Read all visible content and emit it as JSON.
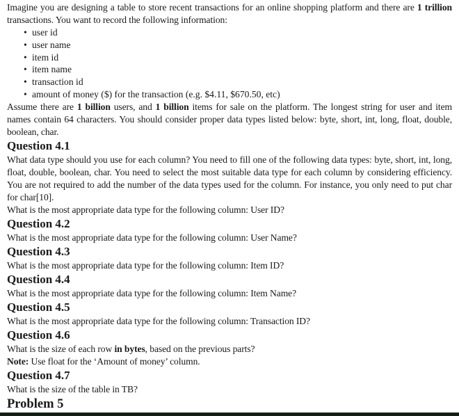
{
  "intro": {
    "part1": "Imagine you are designing a table to store recent transactions for an online shopping platform and there are ",
    "bold1": "1 trillion",
    "part2": " transactions. You want to record the following information:"
  },
  "fields": [
    "user id",
    "user name",
    "item id",
    "item name",
    "transaction id",
    "amount of money ($) for the transaction (e.g. $4.11, $670.50, etc)"
  ],
  "assumption": {
    "part1": "Assume there are ",
    "bold1": "1 billion",
    "part2": " users, and ",
    "bold2": "1 billion",
    "part3": " items for sale on the platform. The longest string for user and item names contain 64 characters. You should consider proper data types listed below: byte, short, int, long, float, double, boolean, char."
  },
  "questions": [
    {
      "title": "Question 4.1",
      "description": "What data type should you use for each column? You need to fill one of the following data types: byte, short, int, long, float, double, boolean, char. You need to select the most suitable data type for each column by considering efficiency. You are not required to add the number of the data types used for the column. For instance, you only need to put char for char[10].",
      "prompt": "What is the most appropriate data type for the following column: User ID?"
    },
    {
      "title": "Question 4.2",
      "prompt": "What is the most appropriate data type for the following column: User Name?"
    },
    {
      "title": "Question 4.3",
      "prompt": "What is the most appropriate data type for the following column: Item ID?"
    },
    {
      "title": "Question 4.4",
      "prompt": "What is the most appropriate data type for the following column: Item Name?"
    },
    {
      "title": "Question 4.5",
      "prompt": "What is the most appropriate data type for the following column: Transaction ID?"
    },
    {
      "title": "Question 4.6",
      "prompt_part1": "What is the size of each row ",
      "prompt_bold": "in bytes",
      "prompt_part2": ", based on the previous parts?",
      "note_label": "Note:",
      "note_text": " Use float for the ‘Amount of money’ column."
    },
    {
      "title": "Question 4.7",
      "prompt": "What is the size of the table in TB?"
    }
  ],
  "next_section": "Problem 5",
  "bullet_glyph": "•"
}
